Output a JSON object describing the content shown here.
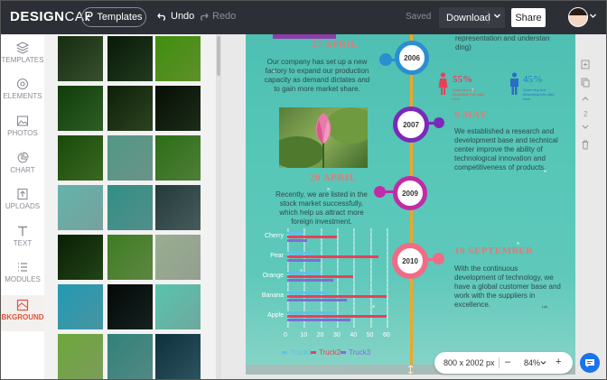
{
  "app": {
    "logo_main": "DESIGN",
    "logo_sub": "CAP"
  },
  "topbar": {
    "templates_label": "Templates",
    "undo_label": "Undo",
    "redo_label": "Redo",
    "saved_label": "Saved",
    "download_label": "Download",
    "share_label": "Share"
  },
  "nav": {
    "items": [
      {
        "label": "TEMPLATES",
        "icon": "layers-icon"
      },
      {
        "label": "ELEMENTS",
        "icon": "elements-icon"
      },
      {
        "label": "PHOTOS",
        "icon": "image-icon"
      },
      {
        "label": "CHART",
        "icon": "pie-chart-icon"
      },
      {
        "label": "UPLOADS",
        "icon": "upload-icon"
      },
      {
        "label": "TEXT",
        "icon": "text-icon"
      },
      {
        "label": "MODULES",
        "icon": "list-icon"
      },
      {
        "label": "BKGROUND",
        "icon": "background-icon"
      }
    ]
  },
  "thumbs": [
    "#4a6b3e",
    "#2e4f2a",
    "#7fbf3a",
    "#3e7d32",
    "#3b5a2c",
    "#263c21",
    "#4f8a2e",
    "#8fc5b7",
    "#6aa84a",
    "#9fd6d1",
    "#6fbfb8",
    "#5f7a7a",
    "#2e5a1e",
    "#7db35a",
    "#c5d3c0",
    "#5fc6d6",
    "#1c2e2a",
    "#95e0d2",
    "#a6cf7a",
    "#6fb6b0",
    "#3b6f7d"
  ],
  "poster": {
    "h_27april": "27 APRIL",
    "p_27april": "Our company has set up a new factory to expand our production capacity as demand dictates and to gain more market share.",
    "y2006": "2006",
    "right_top_text": "representation and understan ding)",
    "stat_1": "55%",
    "stat_1_sub": "Some tiny text describing this data here",
    "stat_2": "45%",
    "stat_2_sub": "Some tiny text describing this data here",
    "y2007": "2007",
    "h_8may": "8 MAY",
    "p_8may": "We established a research and development base and technical center improve the ability of technological innovation and competitiveness of products.",
    "h_20april": "20 APRIL",
    "p_20april": "Recently, we are listed in the stock market successfully, which help us attract more foreign investment.",
    "y2009": "2009",
    "y2010": "2010",
    "h_10sept": "10 SEPTEMBER",
    "p_10sept": "With the continuous development of technology, we have a global customer base and work with the suppliers in excellence.",
    "tiny_tag": "Lyk"
  },
  "colors": {
    "accent": "#e0533b",
    "node_blue": "#2a8fd0",
    "node_purple": "#7b2ab8",
    "node_magenta": "#c22aa8",
    "node_pink": "#f06c86",
    "timeline": "#f1a624",
    "truck1": "#62c0e8",
    "truck2": "#e8405a",
    "truck3": "#7b6fd6"
  },
  "chart_data": {
    "type": "bar",
    "orientation": "horizontal",
    "categories": [
      "Cherry",
      "Pear",
      "Orange",
      "Banana",
      "Apple"
    ],
    "series": [
      {
        "name": "Truck1",
        "values": [
          10,
          15,
          20,
          25,
          30
        ]
      },
      {
        "name": "Truck2",
        "values": [
          30,
          55,
          40,
          60,
          60
        ]
      },
      {
        "name": "Truck3",
        "values": [
          12,
          20,
          28,
          36,
          38
        ]
      }
    ],
    "xticks": [
      "0",
      "10",
      "20",
      "30",
      "40",
      "50",
      "60"
    ],
    "xlim": [
      0,
      60
    ],
    "legend": "bottom"
  },
  "zoom": {
    "size_label": "800 x 2002 px",
    "zoom_label": "84%",
    "minus": "–",
    "plus": "+"
  },
  "page_nav": {
    "page_number": "2"
  }
}
